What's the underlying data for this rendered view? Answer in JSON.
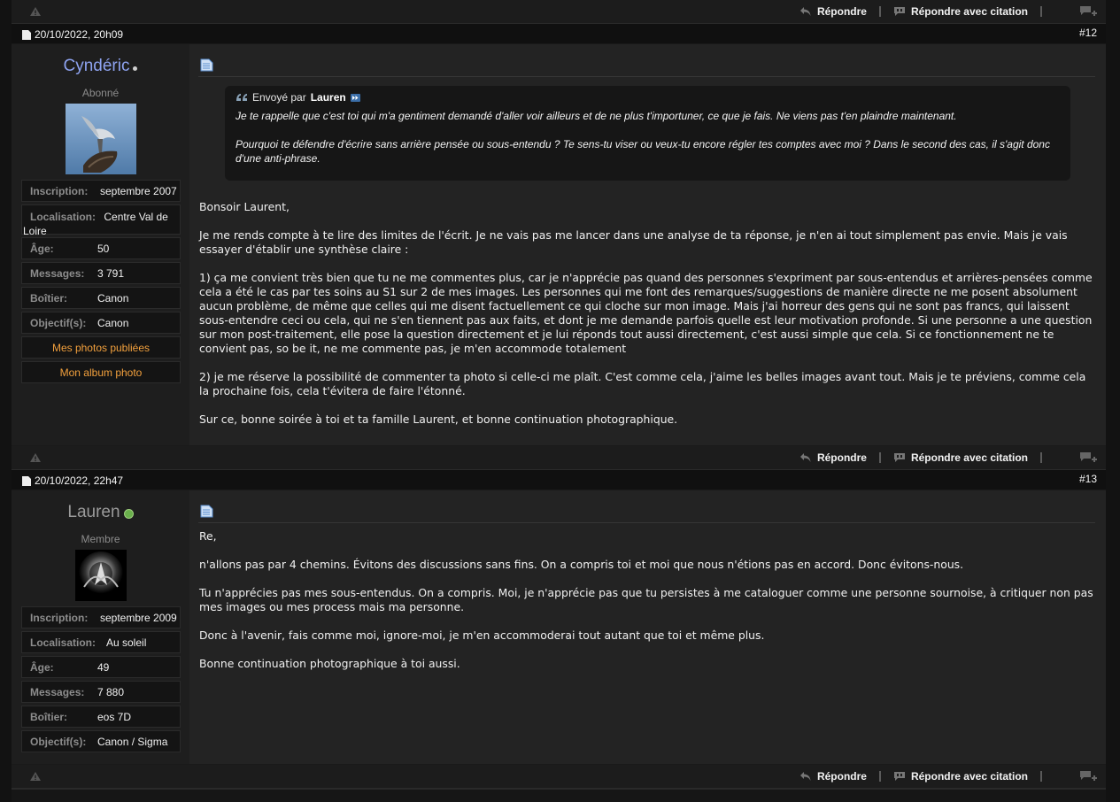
{
  "actions": {
    "reply": "Répondre",
    "reply_quote": "Répondre avec citation"
  },
  "posts": [
    {
      "date": "20/10/2022, 20h09",
      "number": "#12",
      "user": {
        "name": "Cyndéric",
        "name_color": "#8ea3f0",
        "status_color": "#cfcfcf",
        "title": "Abonné",
        "info": [
          {
            "label": "Inscription:",
            "value": "septembre 2007"
          },
          {
            "label": "Localisation:",
            "value": "Centre Val de Loire"
          },
          {
            "label": "Âge:",
            "value": "50"
          },
          {
            "label": "Messages:",
            "value": "3 791"
          },
          {
            "label": "Boîtier:",
            "value": "Canon"
          },
          {
            "label": "Objectif(s):",
            "value": "Canon"
          }
        ],
        "links": [
          "Mes photos publiées",
          "Mon album photo"
        ]
      },
      "quote": {
        "prefix": "Envoyé par",
        "author": "Lauren",
        "paragraphs": [
          "Je te rappelle que c'est toi qui m'a gentiment demandé d'aller voir ailleurs et de ne plus t'importuner, ce que je fais. Ne viens pas t'en plaindre maintenant.",
          "Pourquoi te défendre d'écrire sans arrière pensée ou sous-entendu ? Te sens-tu viser ou veux-tu encore régler tes comptes avec moi ? Dans le second des cas, il s'agit donc d'une anti-phrase."
        ]
      },
      "body": [
        "Bonsoir Laurent,",
        "Je me rends compte à te lire des limites de l'écrit. Je ne vais pas me lancer dans une analyse de ta réponse, je n'en ai tout simplement pas envie. Mais je vais essayer d'établir une synthèse claire :",
        "1) ça me convient très bien que tu ne me commentes plus, car je n'apprécie pas quand des personnes s'expriment par sous-entendus et arrières-pensées comme cela a été le cas par tes soins au S1 sur 2 de mes images. Les personnes qui me font des remarques/suggestions de manière directe ne me posent absolument aucun problème, de même que celles qui me disent factuellement ce qui cloche sur mon image. Mais j'ai horreur des gens qui ne sont pas francs, qui laissent sous-entendre ceci ou cela, qui ne s'en tiennent pas aux faits, et dont je me demande parfois quelle est leur motivation profonde. Si une personne a une question sur mon post-traitement, elle pose la question directement et je lui réponds tout aussi directement, c'est aussi simple que cela. Si ce fonctionnement ne te convient pas, so be it, ne me commente pas, je m'en accommode totalement",
        "2) je me réserve la possibilité de commenter ta photo si celle-ci me plaît. C'est comme cela, j'aime les belles images avant tout. Mais je te préviens, comme cela la prochaine fois, cela t'évitera de faire l'étonné.",
        "Sur ce, bonne soirée à toi et ta famille Laurent, et bonne continuation photographique."
      ]
    },
    {
      "date": "20/10/2022, 22h47",
      "number": "#13",
      "user": {
        "name": "Lauren",
        "name_color": "#9a9a9a",
        "status_color": "#6ab04c",
        "title": "Membre",
        "info": [
          {
            "label": "Inscription:",
            "value": "septembre 2009"
          },
          {
            "label": "Localisation:",
            "value": "Au soleil"
          },
          {
            "label": "Âge:",
            "value": "49"
          },
          {
            "label": "Messages:",
            "value": "7 880"
          },
          {
            "label": "Boîtier:",
            "value": "eos 7D"
          },
          {
            "label": "Objectif(s):",
            "value": "Canon / Sigma"
          }
        ]
      },
      "body": [
        "Re,",
        "n'allons pas par 4 chemins. Évitons des discussions sans fins. On a compris toi et moi que nous n'étions pas en accord. Donc évitons-nous.",
        "Tu n'apprécies pas mes sous-entendus. On a compris. Moi, je n'apprécie pas que tu persistes à me cataloguer comme une personne sournoise, à critiquer non pas mes images ou mes process mais ma personne.",
        "Donc à l'avenir, fais comme moi, ignore-moi, je m'en accommoderai tout autant que toi et même plus.",
        "Bonne continuation photographique à toi aussi."
      ]
    }
  ]
}
